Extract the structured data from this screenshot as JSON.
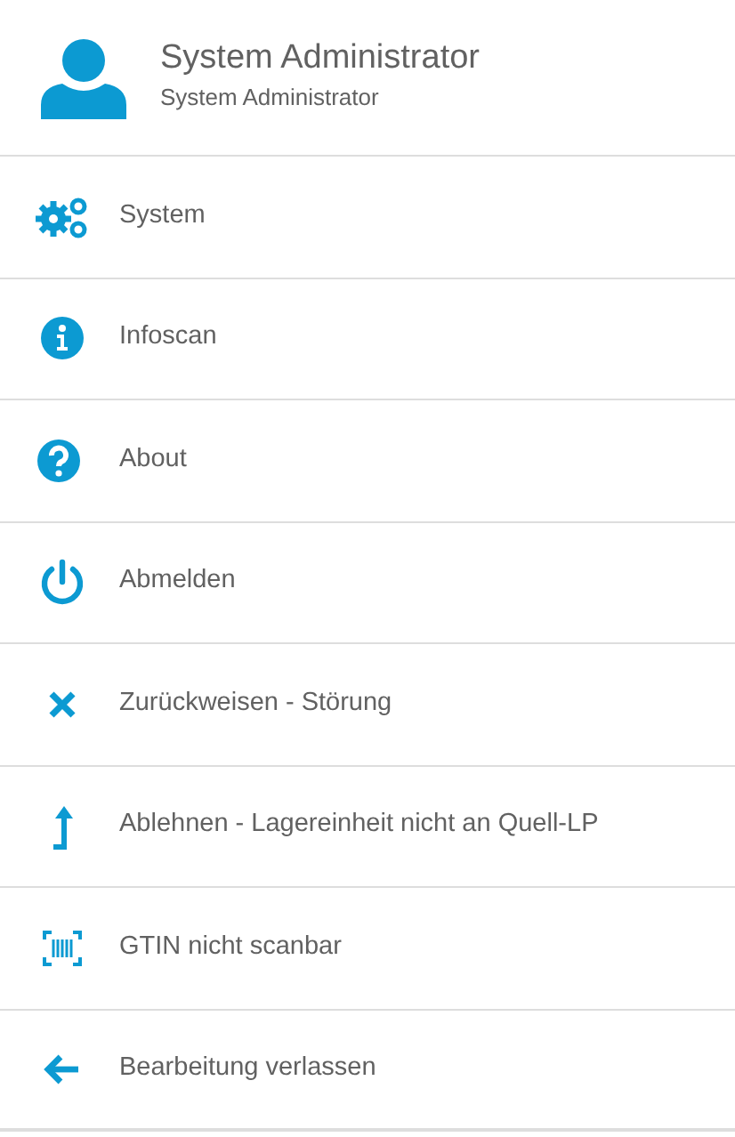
{
  "user": {
    "name": "System Administrator",
    "role": "System Administrator"
  },
  "menu": [
    {
      "kind": "gears",
      "label": "System"
    },
    {
      "kind": "info",
      "label": "Infoscan"
    },
    {
      "kind": "help",
      "label": "About"
    },
    {
      "kind": "power",
      "label": "Abmelden"
    },
    {
      "kind": "close",
      "label": "Zurückweisen - Störung"
    },
    {
      "kind": "turn-up",
      "label": "Ablehnen - Lagereinheit nicht an Quell-LP"
    },
    {
      "kind": "barcode",
      "label": "GTIN nicht scanbar"
    },
    {
      "kind": "back",
      "label": "Bearbeitung verlassen"
    }
  ]
}
